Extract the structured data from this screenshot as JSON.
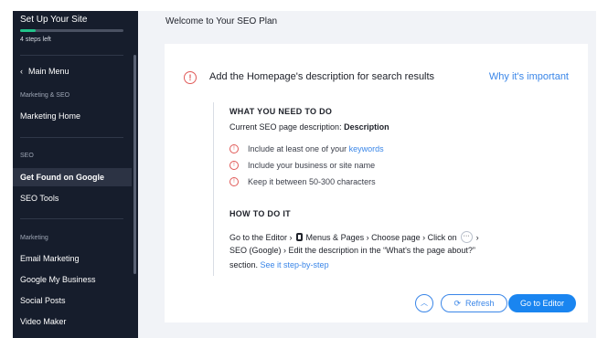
{
  "sidebar": {
    "setup_title": "Set Up Your Site",
    "progress_percent": 15,
    "steps_left": "4 steps left",
    "main_menu": "Main Menu",
    "section_marketing_seo": "Marketing & SEO",
    "marketing_home": "Marketing Home",
    "section_seo": "SEO",
    "get_found": "Get Found on Google",
    "seo_tools": "SEO Tools",
    "section_marketing": "Marketing",
    "email_marketing": "Email Marketing",
    "google_my_business": "Google My Business",
    "social_posts": "Social Posts",
    "video_maker": "Video Maker"
  },
  "main": {
    "title": "Welcome to Your SEO Plan",
    "task_title": "Add the Homepage's description for search results",
    "why_link": "Why it's important",
    "need_heading": "WHAT YOU NEED TO DO",
    "current_desc_label": "Current SEO page description: ",
    "current_desc_value": "Description",
    "req1_text": "Include at least one of your ",
    "req1_link": "keywords",
    "req2": "Include your business or site name",
    "req3": "Keep it between 50-300 characters",
    "how_heading": "HOW TO DO IT",
    "how_go": "Go to the Editor ›",
    "how_menus": "Menus & Pages › Choose page › Click on",
    "how_more_symbol": "···",
    "how_arrow": "›",
    "how_seo": "SEO (Google) ›  Edit the description in the “What's the page about?”",
    "how_section": "section. ",
    "how_link": "See it step-by-step",
    "refresh_label": "Refresh",
    "editor_label": "Go to Editor"
  },
  "colors": {
    "accent": "#1a85f0",
    "sidebar_bg": "#161d2c",
    "progress": "#21c38a",
    "alert": "#e05a58"
  }
}
